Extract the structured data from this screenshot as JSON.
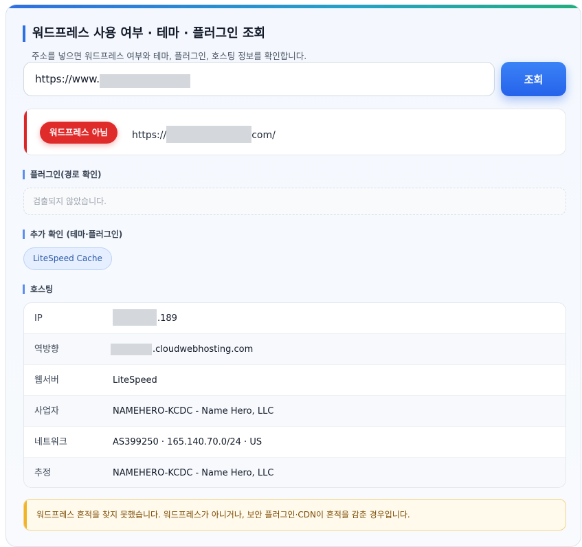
{
  "header": {
    "title": "워드프레스 사용 여부 · 테마 · 플러그인 조회",
    "subtitle": "주소를 넣으면 워드프레스 여부와 테마, 플러그인, 호스팅 정보를 확인합니다."
  },
  "search": {
    "value": "https://www.",
    "button_label": "조회"
  },
  "result": {
    "badge": "워드프레스 아님",
    "url_prefix": "https://",
    "url_suffix": "com/",
    "status_color": "#dc2626"
  },
  "plugins": {
    "label": "플러그인(경로 확인)",
    "empty_text": "검출되지 않았습니다."
  },
  "extra": {
    "label": "추가 확인 (테마·플러그인)",
    "chips": [
      "LiteSpeed Cache"
    ]
  },
  "hosting": {
    "label": "호스팅",
    "rows": [
      {
        "key": "IP",
        "value": ".189"
      },
      {
        "key": "역방향",
        "value": ".cloudwebhosting.com"
      },
      {
        "key": "웹서버",
        "value": "LiteSpeed"
      },
      {
        "key": "사업자",
        "value": "NAMEHERO-KCDC - Name Hero, LLC"
      },
      {
        "key": "네트워크",
        "value": "AS399250 · 165.140.70.0/24 · US"
      },
      {
        "key": "추정",
        "value": "NAMEHERO-KCDC - Name Hero, LLC"
      }
    ]
  },
  "notice": {
    "text": "워드프레스 흔적을 찾지 못했습니다. 워드프레스가 아니거나, 보안 플러그인·CDN이 흔적을 감춘 경우입니다."
  },
  "colors": {
    "accent": "#2563eb",
    "danger": "#dc2626",
    "warning": "#f0b429"
  }
}
